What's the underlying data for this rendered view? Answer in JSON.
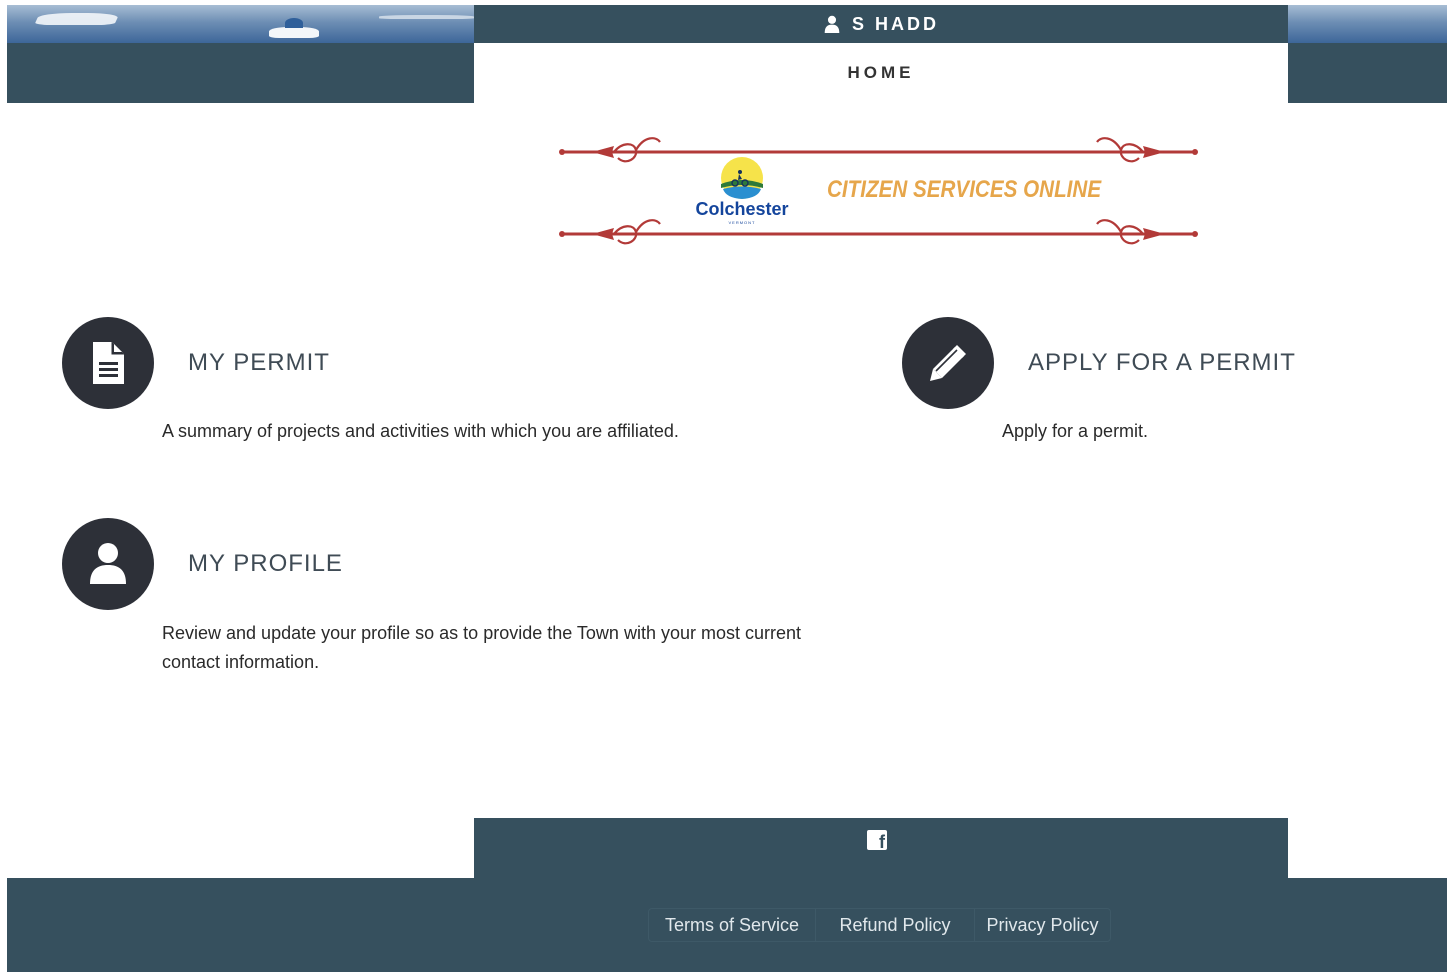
{
  "header": {
    "user_name": "S HADD",
    "nav_home": "HOME"
  },
  "banner": {
    "logo_name": "Colchester",
    "logo_sub": "VERMONT",
    "title": "CITIZEN SERVICES ONLINE"
  },
  "cards": [
    {
      "title": "MY PERMIT",
      "description": "A summary of projects and activities with which you are affiliated.",
      "icon": "document-icon"
    },
    {
      "title": "APPLY FOR A PERMIT",
      "description": "Apply for a permit.",
      "icon": "pencil-icon"
    },
    {
      "title": "MY PROFILE",
      "description": "Review and update your profile so as to provide the Town with your most current contact information.",
      "icon": "user-icon"
    }
  ],
  "footer": {
    "social_icon": "facebook-icon",
    "links": [
      "Terms of Service",
      "Refund Policy",
      "Privacy Policy"
    ]
  },
  "colors": {
    "header_bg": "#36505e",
    "icon_circle": "#2d3038",
    "banner_title": "#e6a64b",
    "ornament": "#b23a38",
    "logo_blue": "#14459c"
  }
}
